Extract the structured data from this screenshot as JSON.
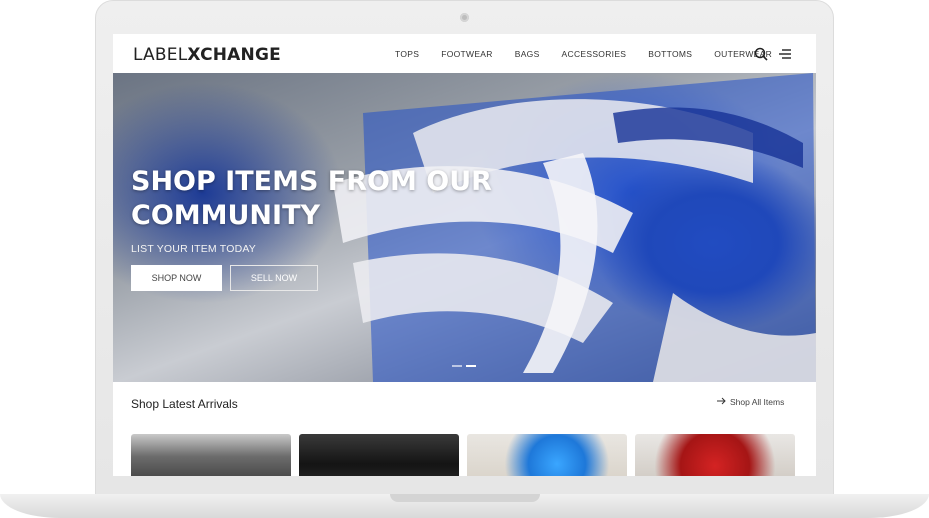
{
  "brand": {
    "logo_part1": "LABEL",
    "logo_part2": "XCHANGE"
  },
  "nav": {
    "items": [
      {
        "label": "TOPS"
      },
      {
        "label": "FOOTWEAR"
      },
      {
        "label": "BAGS"
      },
      {
        "label": "ACCESSORIES"
      },
      {
        "label": "BOTTOMS"
      },
      {
        "label": "OUTERWEAR"
      }
    ],
    "icons": [
      "search-icon",
      "menu-icon"
    ]
  },
  "hero": {
    "title": "SHOP ITEMS FROM OUR COMMUNITY",
    "subtitle": "LIST YOUR ITEM TODAY",
    "primary_button": "SHOP NOW",
    "secondary_button": "SELL NOW",
    "slide_count": 2,
    "active_slide": 2
  },
  "latest": {
    "title": "Shop Latest Arrivals",
    "link": "Shop All Items"
  },
  "colors": {
    "hero_accent": "#1f47c2",
    "text_dark": "#222222"
  }
}
